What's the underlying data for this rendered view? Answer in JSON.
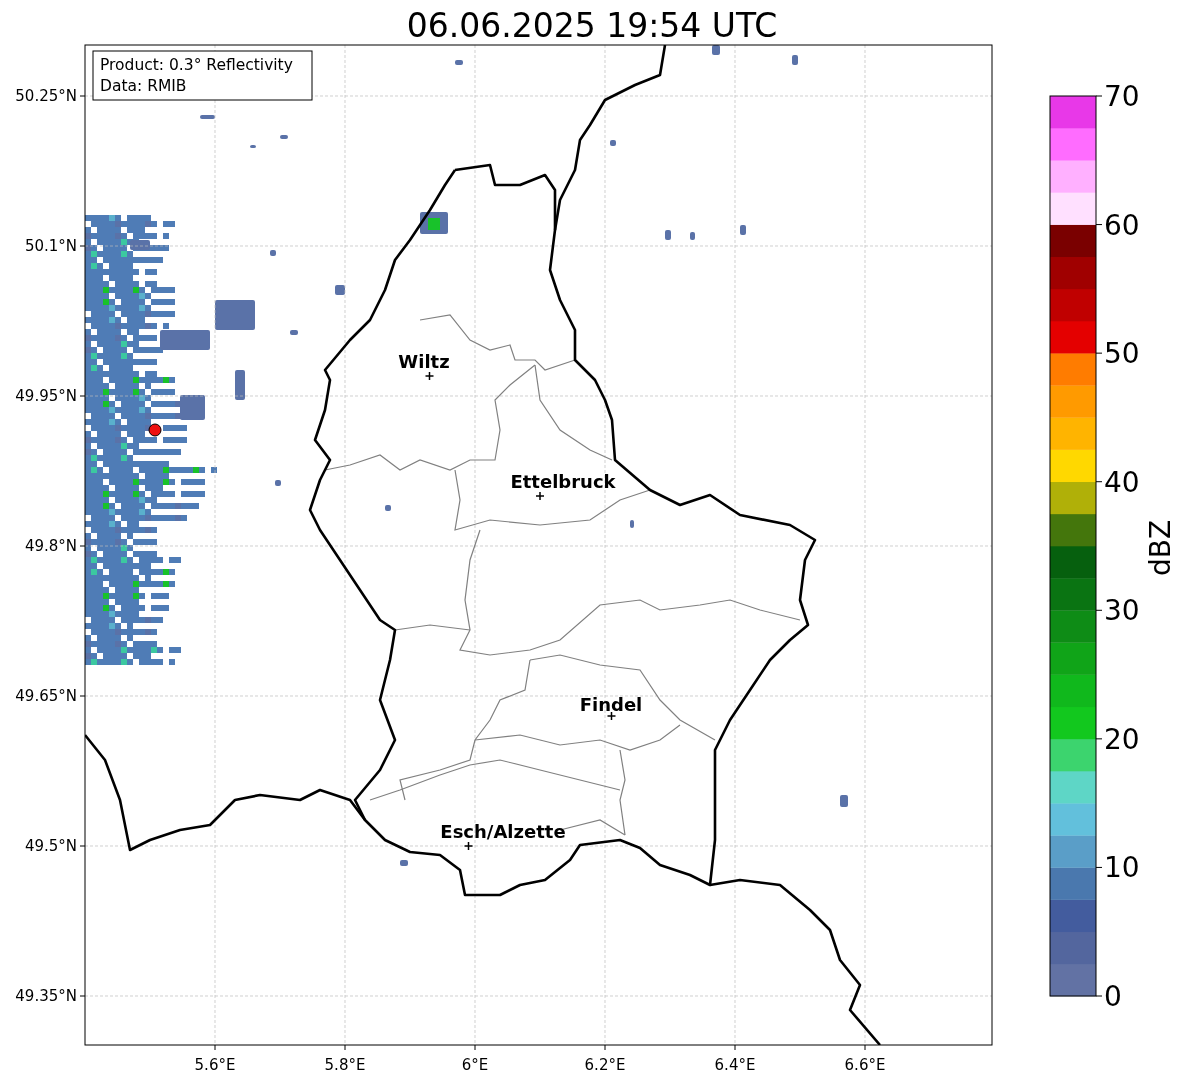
{
  "title": "06.06.2025 19:54 UTC",
  "legend": [
    "Product: 0.3° Reflectivity",
    "Data: RMIB"
  ],
  "map": {
    "x_ticks": [
      "5.6°E",
      "5.8°E",
      "6°E",
      "6.2°E",
      "6.4°E",
      "6.6°E"
    ],
    "y_ticks": [
      "50.25°N",
      "50.1°N",
      "49.95°N",
      "49.8°N",
      "49.65°N",
      "49.5°N",
      "49.35°N"
    ],
    "cities": [
      {
        "name": "Wiltz"
      },
      {
        "name": "Ettelbruck"
      },
      {
        "name": "Findel"
      },
      {
        "name": "Esch/Alzette"
      }
    ]
  },
  "colorbar": {
    "label": "dBZ",
    "ticks": [
      "70",
      "60",
      "50",
      "40",
      "30",
      "20",
      "10",
      "0"
    ],
    "bins": [
      {
        "color": "#6272a4"
      },
      {
        "color": "#53669e"
      },
      {
        "color": "#435c9e"
      },
      {
        "color": "#4a78ae"
      },
      {
        "color": "#5a9ec8"
      },
      {
        "color": "#62c0dc"
      },
      {
        "color": "#5ed6c6"
      },
      {
        "color": "#3cd46e"
      },
      {
        "color": "#12c81e"
      },
      {
        "color": "#10b81c"
      },
      {
        "color": "#10a418"
      },
      {
        "color": "#0e8c16"
      },
      {
        "color": "#0a7412"
      },
      {
        "color": "#06600e"
      },
      {
        "color": "#44760c"
      },
      {
        "color": "#b0b008"
      },
      {
        "color": "#ffd800"
      },
      {
        "color": "#ffb400"
      },
      {
        "color": "#ff9a00"
      },
      {
        "color": "#ff7c00"
      },
      {
        "color": "#e40000"
      },
      {
        "color": "#c00000"
      },
      {
        "color": "#a00000"
      },
      {
        "color": "#7a0000"
      },
      {
        "color": "#ffe0ff"
      },
      {
        "color": "#ffb0ff"
      },
      {
        "color": "#ff6cff"
      },
      {
        "color": "#e838e8"
      }
    ]
  }
}
